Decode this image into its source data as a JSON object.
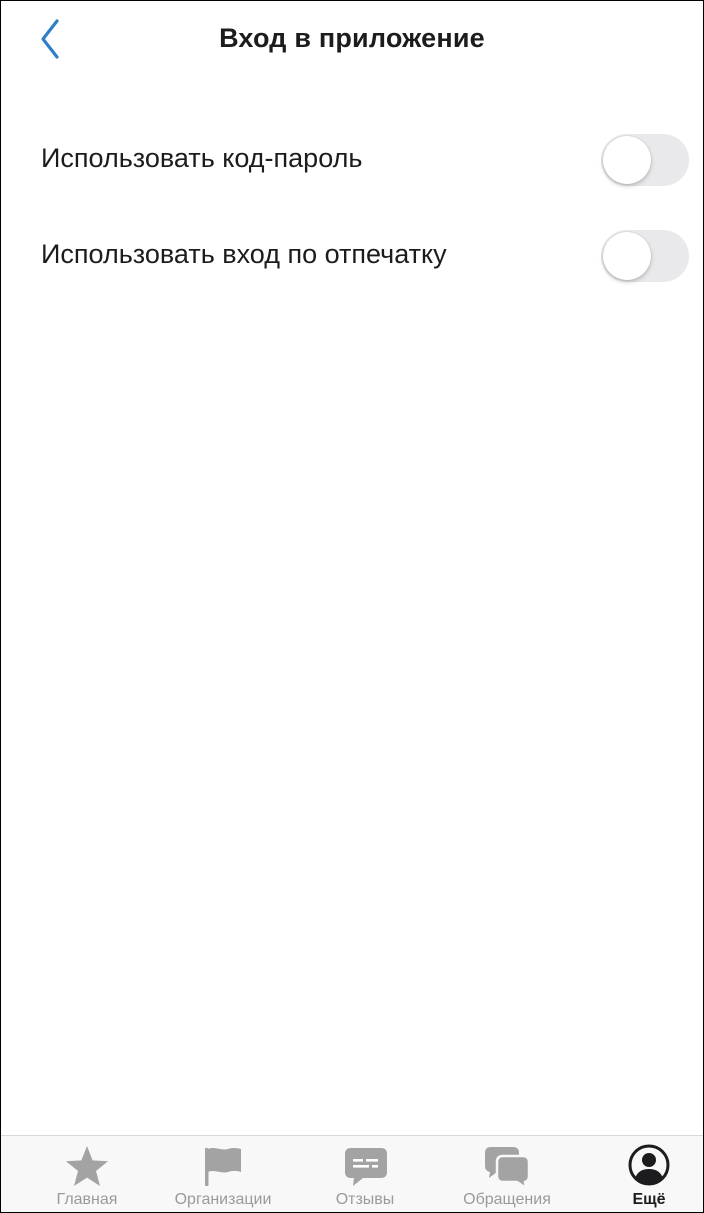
{
  "header": {
    "title": "Вход в приложение",
    "back_icon": "chevron-left-icon"
  },
  "settings": [
    {
      "label": "Использовать код-пароль",
      "enabled": false
    },
    {
      "label": "Использовать вход по отпечатку",
      "enabled": false
    }
  ],
  "tabbar": {
    "items": [
      {
        "label": "Главная",
        "icon": "star-icon",
        "active": false
      },
      {
        "label": "Организации",
        "icon": "flag-icon",
        "active": false
      },
      {
        "label": "Отзывы",
        "icon": "message-bubble-icon",
        "active": false
      },
      {
        "label": "Обращения",
        "icon": "chat-bubbles-icon",
        "active": false
      },
      {
        "label": "Ещё",
        "icon": "user-circle-icon",
        "active": true
      }
    ]
  },
  "colors": {
    "accent": "#2f7fc7",
    "toggle_off": "#e9e9eb",
    "tab_inactive": "#9a9a9a",
    "tab_active": "#1c1c1e"
  }
}
